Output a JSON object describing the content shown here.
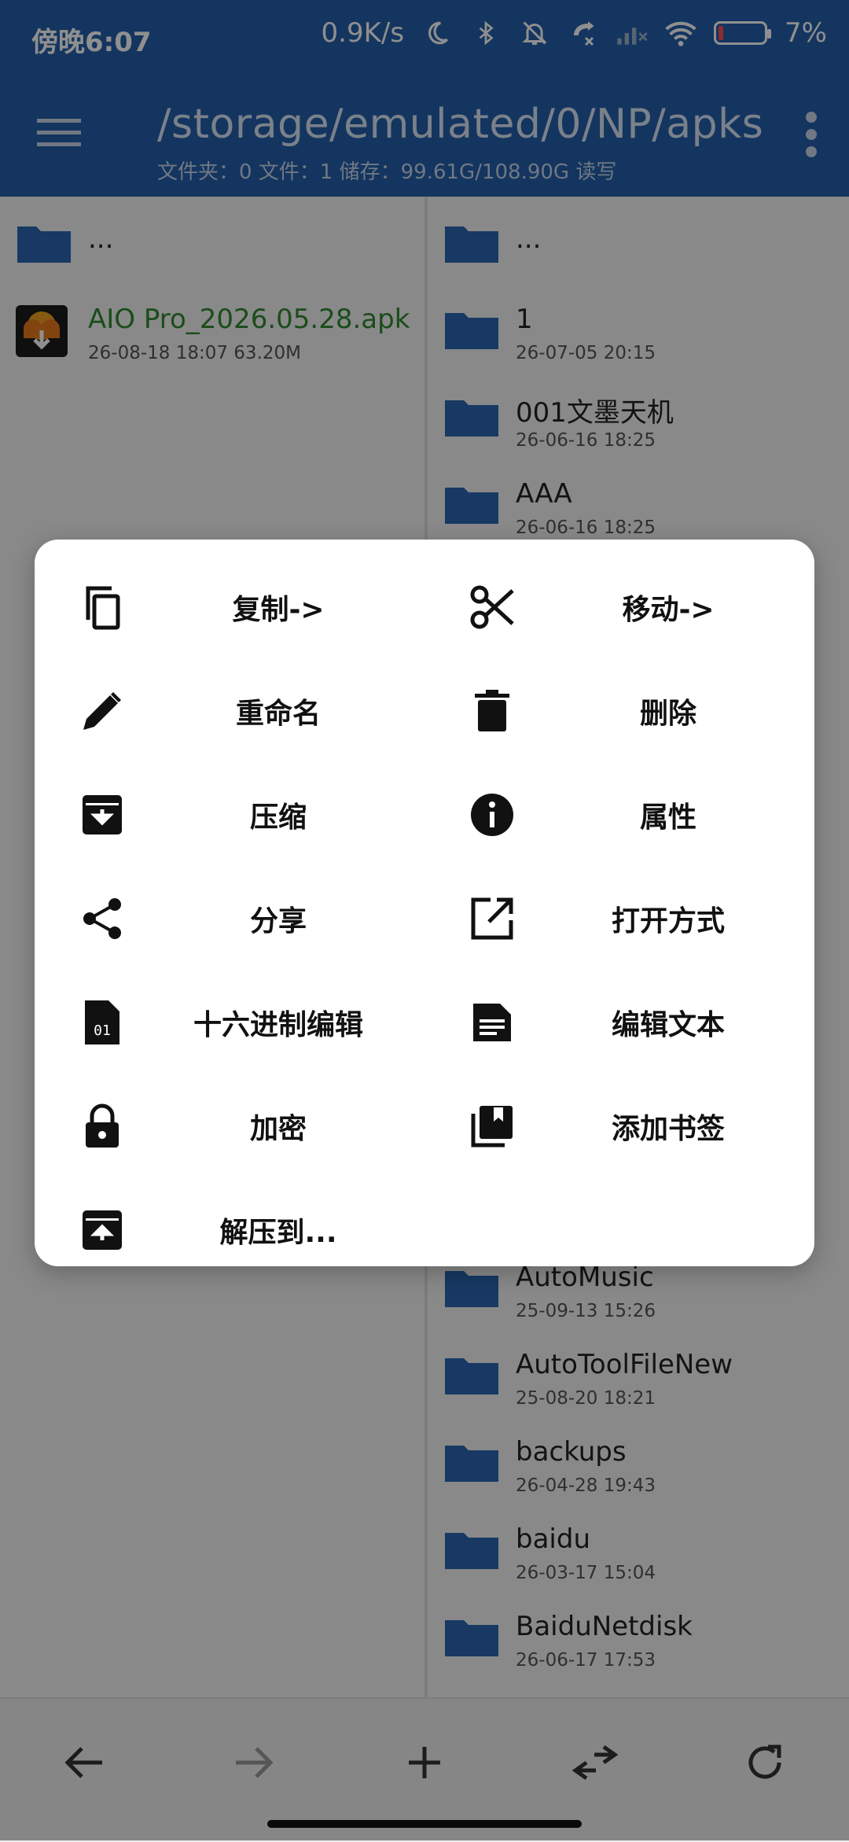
{
  "status": {
    "time": "傍晚6:07",
    "speed": "0.9K/s",
    "battery": "7%"
  },
  "header": {
    "path": "/storage/emulated/0/NP/apks",
    "info": "文件夹：0   文件：1  储存：99.61G/108.90G     读写"
  },
  "left_pane": {
    "items": [
      {
        "name": "..."
      },
      {
        "name": "AIO Pro_2026.05.28.apk",
        "meta": "26-08-18 18:07  63.20M"
      }
    ]
  },
  "right_pane": {
    "items": [
      {
        "name": "..."
      },
      {
        "name": "1",
        "meta": "26-07-05 20:15"
      },
      {
        "name": "001文墨天机",
        "meta": "26-06-16 18:25"
      },
      {
        "name": "AAA",
        "meta": "26-06-16 18:25"
      },
      {
        "name": "AutoMusic",
        "meta": "25-09-13 15:26"
      },
      {
        "name": "AutoToolFileNew",
        "meta": "25-08-20 18:21"
      },
      {
        "name": "backups",
        "meta": "26-04-28 19:43"
      },
      {
        "name": "baidu",
        "meta": "26-03-17 15:04"
      },
      {
        "name": "BaiduNetdisk",
        "meta": "26-06-17 17:53"
      }
    ]
  },
  "menu": {
    "items": [
      {
        "label": "复制->",
        "icon": "copy-icon"
      },
      {
        "label": "移动->",
        "icon": "scissors-icon"
      },
      {
        "label": "重命名",
        "icon": "pencil-icon"
      },
      {
        "label": "删除",
        "icon": "trash-icon"
      },
      {
        "label": "压缩",
        "icon": "archive-icon"
      },
      {
        "label": "属性",
        "icon": "info-icon"
      },
      {
        "label": "分享",
        "icon": "share-icon"
      },
      {
        "label": "打开方式",
        "icon": "open-external-icon"
      },
      {
        "label": "十六进制编辑",
        "icon": "hex-file-icon"
      },
      {
        "label": "编辑文本",
        "icon": "text-file-icon"
      },
      {
        "label": "加密",
        "icon": "lock-icon"
      },
      {
        "label": "添加书签",
        "icon": "bookmark-icon"
      },
      {
        "label": "解压到...",
        "icon": "unarchive-icon"
      }
    ]
  },
  "colors": {
    "appbar": "#245fa9",
    "folder": "#2a66b0",
    "apk_name": "#2f8a2f"
  }
}
